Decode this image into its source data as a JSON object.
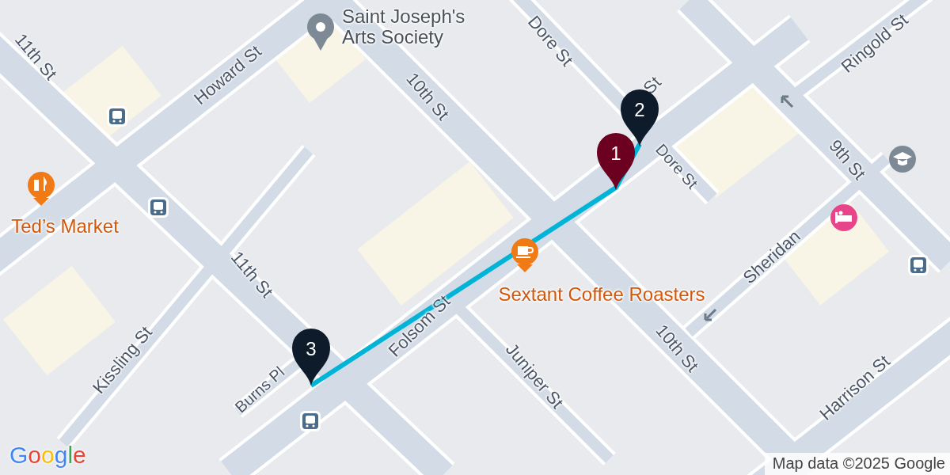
{
  "map": {
    "labels": [
      {
        "text": "Saint Joseph's Arts Society",
        "kind": "place"
      },
      {
        "text": "Dore St",
        "kind": "street"
      },
      {
        "text": "Ringold St",
        "kind": "street"
      },
      {
        "text": "11th St",
        "kind": "street"
      },
      {
        "text": "Howard St",
        "kind": "street"
      },
      {
        "text": "10th St",
        "kind": "street"
      },
      {
        "text": "St",
        "kind": "street"
      },
      {
        "text": "9th St",
        "kind": "street"
      },
      {
        "text": "Dore St",
        "kind": "street"
      },
      {
        "text": "Ted’s Market",
        "kind": "food"
      },
      {
        "text": "11th St",
        "kind": "street"
      },
      {
        "text": "Sheridan",
        "kind": "street"
      },
      {
        "text": "Sextant Coffee Roasters",
        "kind": "food"
      },
      {
        "text": "Folsom St",
        "kind": "street"
      },
      {
        "text": "Kissling St",
        "kind": "street"
      },
      {
        "text": "10th St",
        "kind": "street"
      },
      {
        "text": "Juniper St",
        "kind": "street"
      },
      {
        "text": "Harrison St",
        "kind": "street"
      },
      {
        "text": "Burns Pl",
        "kind": "street"
      }
    ],
    "markers": [
      {
        "label": "2",
        "color": "#0d1b2a"
      },
      {
        "label": "1",
        "color": "#6b0020"
      },
      {
        "label": "3",
        "color": "#0d1b2a"
      }
    ],
    "logo": "Google",
    "attribution": "Map data ©2025 Google"
  }
}
